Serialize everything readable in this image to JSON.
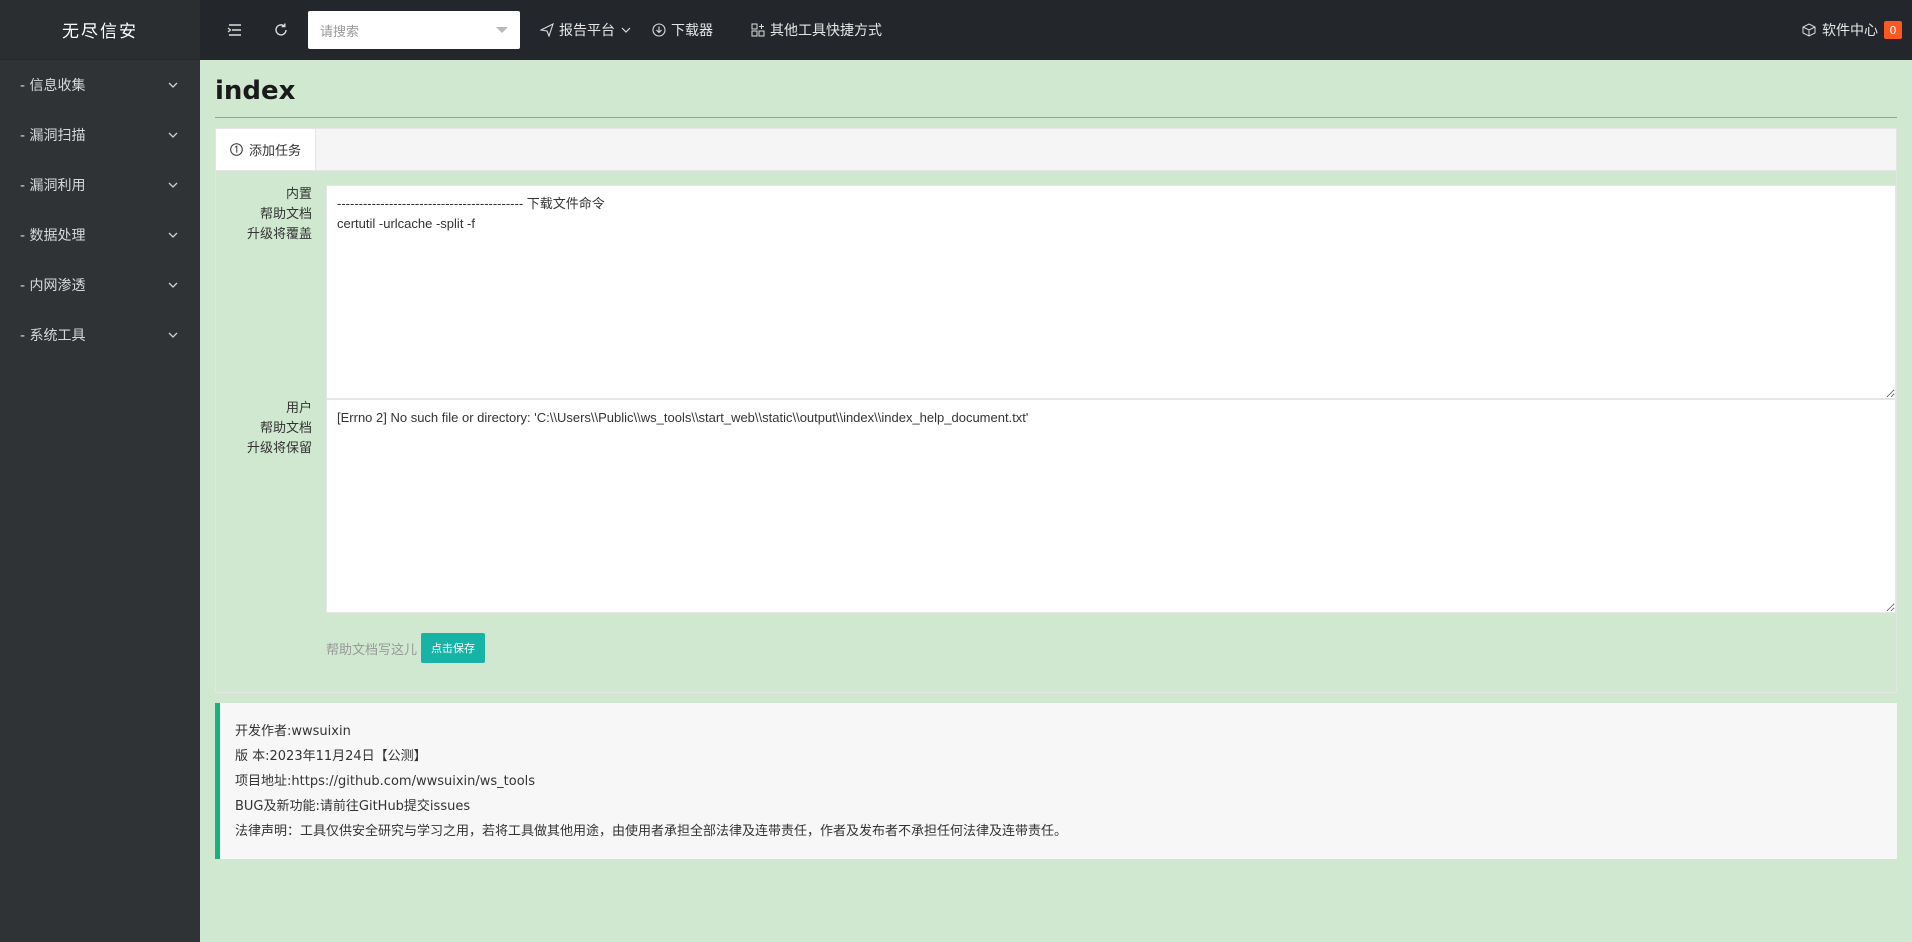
{
  "app": {
    "logo": "无尽信安"
  },
  "sidebar": {
    "items": [
      {
        "label": "- 信息收集"
      },
      {
        "label": "- 漏洞扫描"
      },
      {
        "label": "- 漏洞利用"
      },
      {
        "label": "- 数据处理"
      },
      {
        "label": "- 内网渗透"
      },
      {
        "label": "- 系统工具"
      }
    ]
  },
  "topbar": {
    "search_placeholder": "请搜索",
    "links": [
      {
        "label": "报告平台",
        "icon": "send-icon"
      },
      {
        "label": "下载器",
        "icon": "download-icon"
      },
      {
        "label": "其他工具快捷方式",
        "icon": "apps-icon"
      }
    ],
    "software_center": "软件中心",
    "badge_count": "0"
  },
  "page": {
    "title": "index",
    "tab_label": "添加任务",
    "builtin_label_lines": [
      "内置",
      "帮助文档",
      "升级将覆盖"
    ],
    "builtin_text": "------------------------------------------- 下载文件命令\ncertutil -urlcache -split -f",
    "user_label_lines": [
      "用户",
      "帮助文档",
      "升级将保留"
    ],
    "user_text": "[Errno 2] No such file or directory: 'C:\\\\Users\\\\Public\\\\ws_tools\\\\start_web\\\\static\\\\output\\\\index\\\\index_help_document.txt'",
    "hint": "帮助文档写这儿",
    "save_button": "点击保存"
  },
  "info": {
    "lines": [
      "开发作者:wwsuixin",
      "版 本:2023年11月24日【公测】",
      "项目地址:https://github.com/wwsuixin/ws_tools",
      "BUG及新功能:请前往GitHub提交issues",
      "法律声明：工具仅供安全研究与学习之用，若将工具做其他用途，由使用者承担全部法律及连带责任，作者及发布者不承担任何法律及连带责任。"
    ]
  },
  "colors": {
    "sidebar": "#2f3336",
    "topbar": "#23272b",
    "accent": "#16b3a6",
    "badge": "#ff5722",
    "background": "#cfe8cf"
  }
}
